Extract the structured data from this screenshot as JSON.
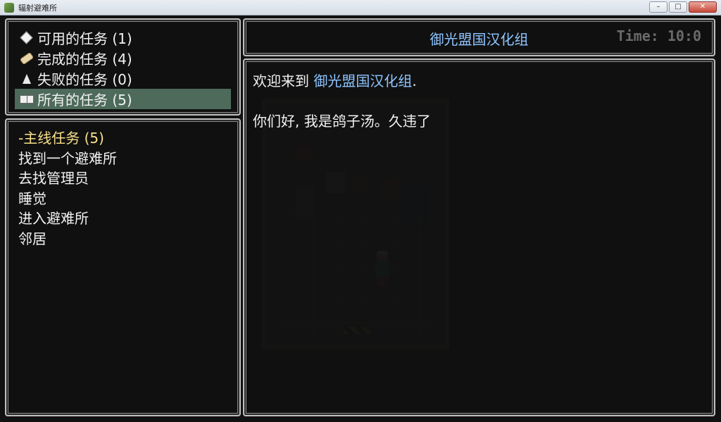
{
  "window": {
    "title": "辐射避难所",
    "minimize_glyph": "–",
    "maximize_glyph": "□",
    "close_glyph": "✕"
  },
  "categories": [
    {
      "icon": "diamond-icon",
      "label": "可用的任务 (1)"
    },
    {
      "icon": "scroll-icon",
      "label": "完成的任务 (4)"
    },
    {
      "icon": "flask-icon",
      "label": "失败的任务 (0)"
    },
    {
      "icon": "book-icon",
      "label": "所有的任务 (5)",
      "selected": true
    }
  ],
  "quests": {
    "header": "-主线任务 (5)",
    "items": [
      "找到一个避难所",
      "去找管理员",
      "睡觉",
      "进入避难所",
      "邻居"
    ]
  },
  "detail": {
    "title": "御光盟国汉化组",
    "time": "Time: 10:0",
    "line1_prefix": "欢迎来到 ",
    "line1_highlight": "御光盟国汉化组",
    "line1_suffix": ".",
    "line2": "你们好, 我是鸽子汤。久违了"
  },
  "colors": {
    "selection": "#4d6a5b",
    "highlight_text": "#8ec5ff",
    "header_text": "#f7e08a",
    "panel_bg": "#101010"
  }
}
